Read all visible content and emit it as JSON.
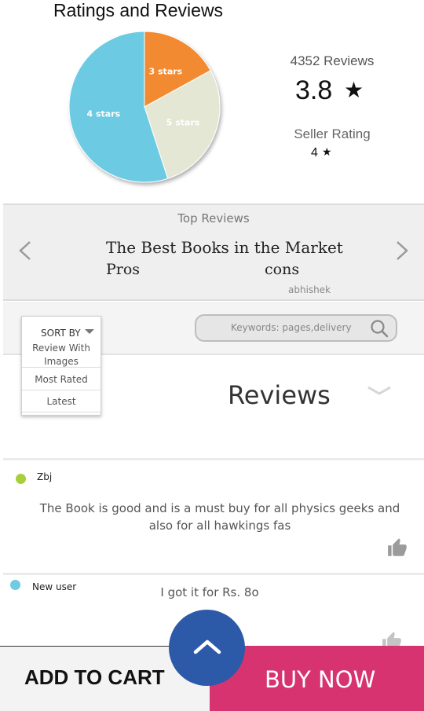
{
  "ratings": {
    "title": "Ratings and Reviews",
    "reviews_count": "4352 Reviews",
    "average": "3.8",
    "seller_label": "Seller Rating",
    "seller_value": "4"
  },
  "chart_data": {
    "type": "pie",
    "slices": [
      {
        "label": "3 stars",
        "value": 17,
        "color": "#f28a30"
      },
      {
        "label": "5 stars",
        "value": 28,
        "color": "#e3e7d3"
      },
      {
        "label": "4 stars",
        "value": 55,
        "color": "#6ccbe3"
      }
    ]
  },
  "top_reviews": {
    "title": "Top Reviews",
    "heading": "The Best Books in the Market",
    "pros": "Pros",
    "cons": "cons",
    "author": "abhishek"
  },
  "sort": {
    "label": "SORT BY",
    "options": [
      "Review With Images",
      "Most Rated",
      "Latest"
    ]
  },
  "search": {
    "placeholder": "Keywords: pages,delivery"
  },
  "reviews_heading": "Reviews",
  "reviews": [
    {
      "user": "Zbj",
      "text": "The Book is good and is a must buy for all physics geeks and also for all hawkings fas",
      "dot_color": "#a6cf3b"
    },
    {
      "user": "New user",
      "text": "I got it for Rs. 8o",
      "dot_color": "#6fcbe2"
    }
  ],
  "bottom_bar": {
    "add_to_cart": "ADD TO CART",
    "buy_now": "BUY NOW"
  },
  "colors": {
    "buy_now": "#d63370",
    "fab": "#2c5aa8"
  }
}
